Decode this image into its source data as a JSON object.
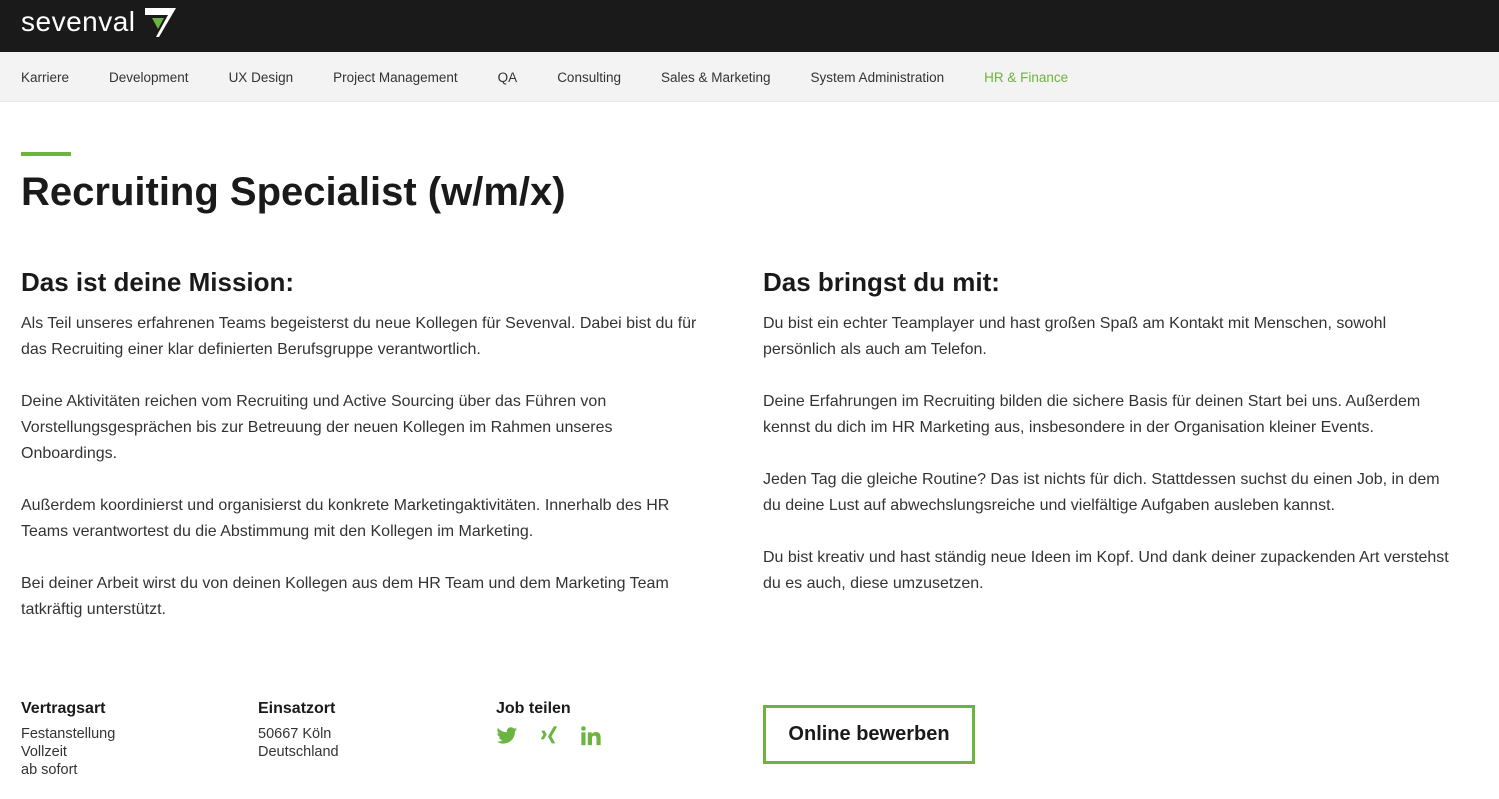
{
  "brand": {
    "name": "sevenval",
    "accent_color": "#6db33f",
    "header_bg": "#1a1a1a"
  },
  "nav": {
    "items": [
      {
        "label": "Karriere",
        "active": false
      },
      {
        "label": "Development",
        "active": false
      },
      {
        "label": "UX Design",
        "active": false
      },
      {
        "label": "Project Management",
        "active": false
      },
      {
        "label": "QA",
        "active": false
      },
      {
        "label": "Consulting",
        "active": false
      },
      {
        "label": "Sales & Marketing",
        "active": false
      },
      {
        "label": "System Administration",
        "active": false
      },
      {
        "label": "HR & Finance",
        "active": true
      }
    ]
  },
  "job": {
    "title": "Recruiting Specialist (w/m/x)"
  },
  "mission": {
    "heading": "Das ist deine Mission:",
    "paragraphs": [
      "Als Teil unseres erfahrenen Teams begeisterst du neue Kollegen für Sevenval. Dabei bist du für das Recruiting einer klar definierten Berufsgruppe verantwortlich.",
      "Deine Aktivitäten reichen vom Recruiting und Active Sourcing über das Führen von Vorstellungsgesprächen bis zur Betreuung der neuen Kollegen im Rahmen unseres Onboardings.",
      "Außerdem koordinierst und organisierst du konkrete Marketingaktivitäten. Innerhalb des HR Teams verantwortest du die Abstimmung mit den Kollegen im Marketing.",
      "Bei deiner Arbeit wirst du von deinen Kollegen aus dem HR Team und dem Marketing Team tatkräftig unterstützt."
    ]
  },
  "requirements": {
    "heading": "Das bringst du mit:",
    "paragraphs": [
      "Du bist ein echter Teamplayer und hast großen Spaß am Kontakt mit Menschen, sowohl persönlich als auch am Telefon.",
      "Deine Erfahrungen im Recruiting bilden die sichere Basis für deinen Start bei uns. Außerdem kennst du dich im HR Marketing aus, insbesondere in der Organisation kleiner Events.",
      "Jeden Tag die gleiche Routine? Das ist nichts für dich. Stattdessen suchst du einen Job, in dem du deine Lust auf abwechslungsreiche und vielfältige Aufgaben ausleben kannst.",
      "Du bist kreativ und hast ständig neue Ideen im Kopf. Und dank deiner zupackenden Art verstehst du es auch, diese umzusetzen."
    ]
  },
  "contract": {
    "label": "Vertragsart",
    "lines": [
      "Festanstellung",
      "Vollzeit",
      "ab sofort"
    ]
  },
  "location": {
    "label": "Einsatzort",
    "lines": [
      "50667 Köln",
      "Deutschland"
    ]
  },
  "share": {
    "label": "Job teilen",
    "icons": [
      "twitter-icon",
      "xing-icon",
      "linkedin-icon"
    ]
  },
  "apply": {
    "label": "Online bewerben"
  }
}
